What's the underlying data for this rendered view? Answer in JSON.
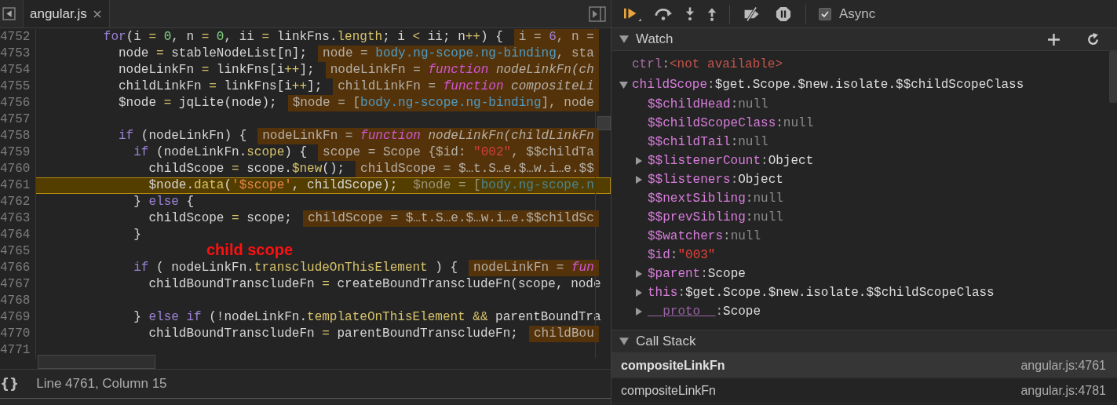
{
  "editor": {
    "tabs": [
      {
        "label": "angular.js",
        "selected": true
      }
    ],
    "lines": [
      {
        "number": "4752",
        "current": false,
        "code": [
          {
            "kind": "keyword",
            "text": "        for"
          },
          {
            "kind": "plain",
            "text": "(i "
          },
          {
            "kind": "operator",
            "text": "="
          },
          {
            "kind": "number",
            "text": " 0"
          },
          {
            "kind": "plain",
            "text": ", n "
          },
          {
            "kind": "operator",
            "text": "="
          },
          {
            "kind": "number",
            "text": " 0"
          },
          {
            "kind": "plain",
            "text": ", ii "
          },
          {
            "kind": "operator",
            "text": "="
          },
          {
            "kind": "plain",
            "text": " linkFns."
          },
          {
            "kind": "property",
            "text": "length"
          },
          {
            "kind": "plain",
            "text": "; i "
          },
          {
            "kind": "operator",
            "text": "<"
          },
          {
            "kind": "plain",
            "text": " ii; n"
          },
          {
            "kind": "operator",
            "text": "++"
          },
          {
            "kind": "plain",
            "text": ") {"
          }
        ],
        "value": [
          {
            "kind": "plain",
            "text": "i = "
          },
          {
            "kind": "valnum",
            "text": "6"
          },
          {
            "kind": "plain",
            "text": ", n ="
          }
        ]
      },
      {
        "number": "4753",
        "current": false,
        "code": [
          {
            "kind": "plain",
            "text": "          node "
          },
          {
            "kind": "operator",
            "text": "="
          },
          {
            "kind": "plain",
            "text": " stableNodeList[n];"
          }
        ],
        "value": [
          {
            "kind": "plain",
            "text": "node = "
          },
          {
            "kind": "dom",
            "text": "body.ng-scope.ng-binding"
          },
          {
            "kind": "plain",
            "text": ", sta"
          }
        ]
      },
      {
        "number": "4754",
        "current": false,
        "code": [
          {
            "kind": "plain",
            "text": "          nodeLinkFn "
          },
          {
            "kind": "operator",
            "text": "="
          },
          {
            "kind": "plain",
            "text": " linkFns[i"
          },
          {
            "kind": "operator",
            "text": "++"
          },
          {
            "kind": "plain",
            "text": "];"
          }
        ],
        "value": [
          {
            "kind": "plain",
            "text": "nodeLinkFn = "
          },
          {
            "kind": "fn",
            "text": "function"
          },
          {
            "kind": "italic",
            "text": " nodeLinkFn(ch"
          }
        ]
      },
      {
        "number": "4755",
        "current": false,
        "code": [
          {
            "kind": "plain",
            "text": "          childLinkFn "
          },
          {
            "kind": "operator",
            "text": "="
          },
          {
            "kind": "plain",
            "text": " linkFns[i"
          },
          {
            "kind": "operator",
            "text": "++"
          },
          {
            "kind": "plain",
            "text": "];"
          }
        ],
        "value": [
          {
            "kind": "plain",
            "text": "childLinkFn = "
          },
          {
            "kind": "fn",
            "text": "function"
          },
          {
            "kind": "italic",
            "text": " compositeLi"
          }
        ]
      },
      {
        "number": "4756",
        "current": false,
        "code": [
          {
            "kind": "plain",
            "text": "          $node "
          },
          {
            "kind": "operator",
            "text": "="
          },
          {
            "kind": "plain",
            "text": " jqLite(node);"
          }
        ],
        "value": [
          {
            "kind": "plain",
            "text": "$node = ["
          },
          {
            "kind": "dom",
            "text": "body.ng-scope.ng-binding"
          },
          {
            "kind": "plain",
            "text": "], node"
          }
        ]
      },
      {
        "number": "4757",
        "current": false
      },
      {
        "number": "4758",
        "current": false,
        "code": [
          {
            "kind": "keyword",
            "text": "          if"
          },
          {
            "kind": "plain",
            "text": " (nodeLinkFn) {"
          }
        ],
        "value": [
          {
            "kind": "plain",
            "text": "nodeLinkFn = "
          },
          {
            "kind": "fn",
            "text": "function"
          },
          {
            "kind": "italic",
            "text": " nodeLinkFn(childLinkFn"
          }
        ]
      },
      {
        "number": "4759",
        "current": false,
        "code": [
          {
            "kind": "keyword",
            "text": "            if"
          },
          {
            "kind": "plain",
            "text": " (nodeLinkFn."
          },
          {
            "kind": "property",
            "text": "scope"
          },
          {
            "kind": "plain",
            "text": ") {"
          }
        ],
        "value": [
          {
            "kind": "plain",
            "text": "scope = Scope {$id: "
          },
          {
            "kind": "strval",
            "text": "\"002\""
          },
          {
            "kind": "plain",
            "text": ", $$childTa"
          }
        ]
      },
      {
        "number": "4760",
        "current": false,
        "code": [
          {
            "kind": "plain",
            "text": "              childScope "
          },
          {
            "kind": "operator",
            "text": "="
          },
          {
            "kind": "plain",
            "text": " scope."
          },
          {
            "kind": "property",
            "text": "$new"
          },
          {
            "kind": "plain",
            "text": "();"
          }
        ],
        "value": [
          {
            "kind": "plain",
            "text": "childScope = $…t.S…e.$…w.i…e.$$"
          }
        ]
      },
      {
        "number": "4761",
        "current": true,
        "code": [
          {
            "kind": "plain",
            "text": "              $node."
          },
          {
            "kind": "property",
            "text": "data"
          },
          {
            "kind": "plain",
            "text": "("
          },
          {
            "kind": "string",
            "text": "'$scope'"
          },
          {
            "kind": "plain",
            "text": ", childScope);"
          }
        ],
        "value": [
          {
            "kind": "plain",
            "text": "$node = ["
          },
          {
            "kind": "dom",
            "text": "body.ng-scope.n"
          }
        ]
      },
      {
        "number": "4762",
        "current": false,
        "code": [
          {
            "kind": "plain",
            "text": "            } "
          },
          {
            "kind": "keyword",
            "text": "else"
          },
          {
            "kind": "plain",
            "text": " {"
          }
        ]
      },
      {
        "number": "4763",
        "current": false,
        "code": [
          {
            "kind": "plain",
            "text": "              childScope "
          },
          {
            "kind": "operator",
            "text": "="
          },
          {
            "kind": "plain",
            "text": " scope;"
          }
        ],
        "value": [
          {
            "kind": "plain",
            "text": "childScope = $…t.S…e.$…w.i…e.$$childSc"
          }
        ]
      },
      {
        "number": "4764",
        "current": false,
        "code": [
          {
            "kind": "plain",
            "text": "            }"
          }
        ]
      },
      {
        "number": "4765",
        "current": false
      },
      {
        "number": "4766",
        "current": false,
        "code": [
          {
            "kind": "keyword",
            "text": "            if"
          },
          {
            "kind": "plain",
            "text": " ( nodeLinkFn."
          },
          {
            "kind": "property",
            "text": "transcludeOnThisElement"
          },
          {
            "kind": "plain",
            "text": " ) {"
          }
        ],
        "value": [
          {
            "kind": "plain",
            "text": "nodeLinkFn = "
          },
          {
            "kind": "fn",
            "text": "fun"
          }
        ]
      },
      {
        "number": "4767",
        "current": false,
        "code": [
          {
            "kind": "plain",
            "text": "              childBoundTranscludeFn "
          },
          {
            "kind": "operator",
            "text": "="
          },
          {
            "kind": "plain",
            "text": " createBoundTranscludeFn(scope, node"
          }
        ]
      },
      {
        "number": "4768",
        "current": false
      },
      {
        "number": "4769",
        "current": false,
        "code": [
          {
            "kind": "plain",
            "text": "            } "
          },
          {
            "kind": "keyword",
            "text": "else if"
          },
          {
            "kind": "plain",
            "text": " (!nodeLinkFn."
          },
          {
            "kind": "property",
            "text": "templateOnThisElement"
          },
          {
            "kind": "operator",
            "text": " &&"
          },
          {
            "kind": "plain",
            "text": " parentBoundTra"
          }
        ]
      },
      {
        "number": "4770",
        "current": false,
        "code": [
          {
            "kind": "plain",
            "text": "              childBoundTranscludeFn "
          },
          {
            "kind": "operator",
            "text": "="
          },
          {
            "kind": "plain",
            "text": " parentBoundTranscludeFn;"
          }
        ],
        "value": [
          {
            "kind": "plain",
            "text": "childBou"
          }
        ]
      },
      {
        "number": "4771",
        "current": false
      }
    ],
    "annotation": "child scope",
    "status_bar": {
      "format_button": "{}",
      "position": "Line 4761, Column 15"
    }
  },
  "debugger": {
    "toolbar": {
      "async": {
        "label": "Async",
        "checked": true
      }
    },
    "watch": {
      "title": "Watch",
      "expanded": true,
      "separator": ":",
      "items": [
        {
          "key": "ctrl",
          "kind": "unavailable",
          "value": "<not available>"
        },
        {
          "key": "childScope",
          "kind": "object",
          "value": "$get.Scope.$new.isolate.$$childScopeClass",
          "expanded": true,
          "children": [
            {
              "key": "$$childHead",
              "kind": "null",
              "value": "null"
            },
            {
              "key": "$$childScopeClass",
              "kind": "null",
              "value": "null"
            },
            {
              "key": "$$childTail",
              "kind": "null",
              "value": "null"
            },
            {
              "key": "$$listenerCount",
              "kind": "object",
              "value": "Object",
              "expanded": false
            },
            {
              "key": "$$listeners",
              "kind": "object",
              "value": "Object",
              "expanded": false
            },
            {
              "key": "$$nextSibling",
              "kind": "null",
              "value": "null"
            },
            {
              "key": "$$prevSibling",
              "kind": "null",
              "value": "null"
            },
            {
              "key": "$$watchers",
              "kind": "null",
              "value": "null"
            },
            {
              "key": "$id",
              "kind": "string",
              "value": "\"003\""
            },
            {
              "key": "$parent",
              "kind": "object",
              "value": "Scope",
              "expanded": false
            },
            {
              "key": "this",
              "kind": "object",
              "value": "$get.Scope.$new.isolate.$$childScopeClass",
              "expanded": false
            },
            {
              "key": "__proto__",
              "kind": "proto",
              "value": "Scope",
              "expanded": false
            }
          ]
        }
      ]
    },
    "call_stack": {
      "title": "Call Stack",
      "expanded": true,
      "frames": [
        {
          "name": "compositeLinkFn",
          "location": "angular.js:4761",
          "selected": true
        },
        {
          "name": "compositeLinkFn",
          "location": "angular.js:4781",
          "selected": false
        }
      ]
    }
  }
}
